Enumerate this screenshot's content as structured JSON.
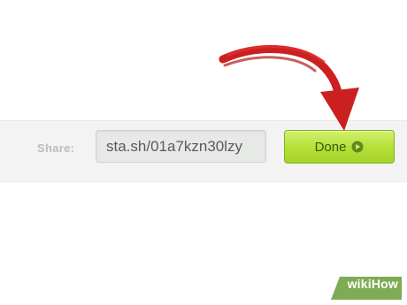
{
  "share": {
    "label": "Share:",
    "url_value": "sta.sh/01a7kzn30lzy"
  },
  "done_button": {
    "label": "Done",
    "icon": "circle-play-icon"
  },
  "annotation": {
    "arrow": "red-curved-arrow",
    "arrow_color": "#cc1f1f"
  },
  "watermark": {
    "text_part1": "wiki",
    "text_part2": "How"
  },
  "colors": {
    "bar_background": "#f3f3f3",
    "button_green": "#b4df37"
  }
}
